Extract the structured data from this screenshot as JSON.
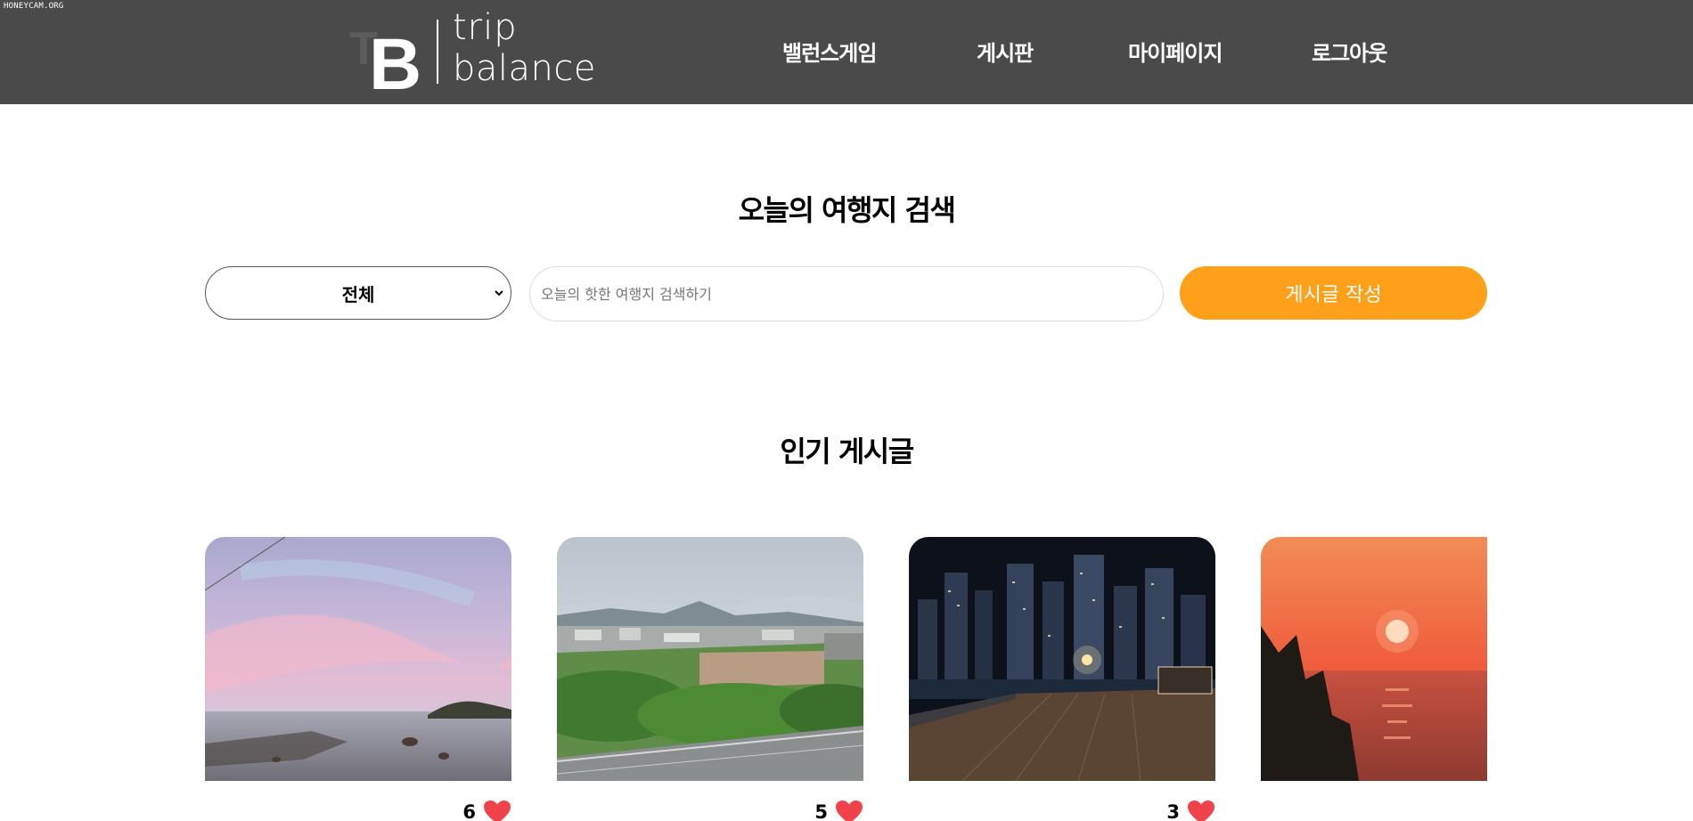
{
  "watermark": "HONEYCAM.ORG",
  "header": {
    "logo": {
      "mark": "TB",
      "line1": "trip",
      "line2": "balance"
    },
    "nav": [
      {
        "label": "밸런스게임"
      },
      {
        "label": "게시판"
      },
      {
        "label": "마이페이지"
      },
      {
        "label": "로그아웃"
      }
    ]
  },
  "search": {
    "title": "오늘의 여행지 검색",
    "category_selected": "전체",
    "placeholder": "오늘의 핫한 여행지 검색하기",
    "value": "",
    "write_button_label": "게시글 작성"
  },
  "popular": {
    "title": "인기 게시글",
    "posts": [
      {
        "photo": "pink-sky-coast",
        "likes": "6"
      },
      {
        "photo": "green-hills-city-view",
        "likes": "5"
      },
      {
        "photo": "night-city-boardwalk",
        "likes": "3"
      },
      {
        "photo": "red-sunset-sea",
        "likes": ""
      }
    ]
  },
  "colors": {
    "header_bg": "#4a4a4a",
    "accent": "#ffa01b",
    "heart": "#f0424a"
  }
}
